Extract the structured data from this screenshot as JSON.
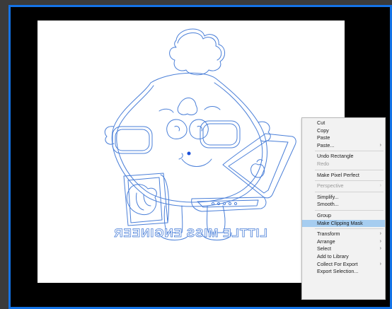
{
  "artwork": {
    "text": "LITTLE MISS ENGINEER",
    "line_color": "#4a7fd8"
  },
  "context_menu": {
    "groups": [
      [
        {
          "label": "Cut",
          "submenu": false,
          "disabled": false
        },
        {
          "label": "Copy",
          "submenu": false,
          "disabled": false
        },
        {
          "label": "Paste",
          "submenu": false,
          "disabled": false
        },
        {
          "label": "Paste...",
          "submenu": true,
          "disabled": false
        }
      ],
      [
        {
          "label": "Undo Rectangle",
          "submenu": false,
          "disabled": false
        },
        {
          "label": "Redo",
          "submenu": false,
          "disabled": true
        }
      ],
      [
        {
          "label": "Make Pixel Perfect",
          "submenu": false,
          "disabled": false
        }
      ],
      [
        {
          "label": "Perspective",
          "submenu": true,
          "disabled": true
        }
      ],
      [
        {
          "label": "Simplify...",
          "submenu": false,
          "disabled": false
        },
        {
          "label": "Smooth...",
          "submenu": false,
          "disabled": false
        }
      ],
      [
        {
          "label": "Group",
          "submenu": false,
          "disabled": false
        },
        {
          "label": "Make Clipping Mask",
          "submenu": false,
          "disabled": false,
          "active": true
        }
      ],
      [
        {
          "label": "Transform",
          "submenu": true,
          "disabled": false
        },
        {
          "label": "Arrange",
          "submenu": true,
          "disabled": false
        },
        {
          "label": "Select",
          "submenu": true,
          "disabled": false
        },
        {
          "label": "Add to Library",
          "submenu": false,
          "disabled": false
        },
        {
          "label": "Collect For Export",
          "submenu": true,
          "disabled": false
        },
        {
          "label": "Export Selection...",
          "submenu": false,
          "disabled": false
        }
      ]
    ]
  },
  "colors": {
    "selection_border": "#1473e6",
    "highlight": "#a6cdf0"
  }
}
